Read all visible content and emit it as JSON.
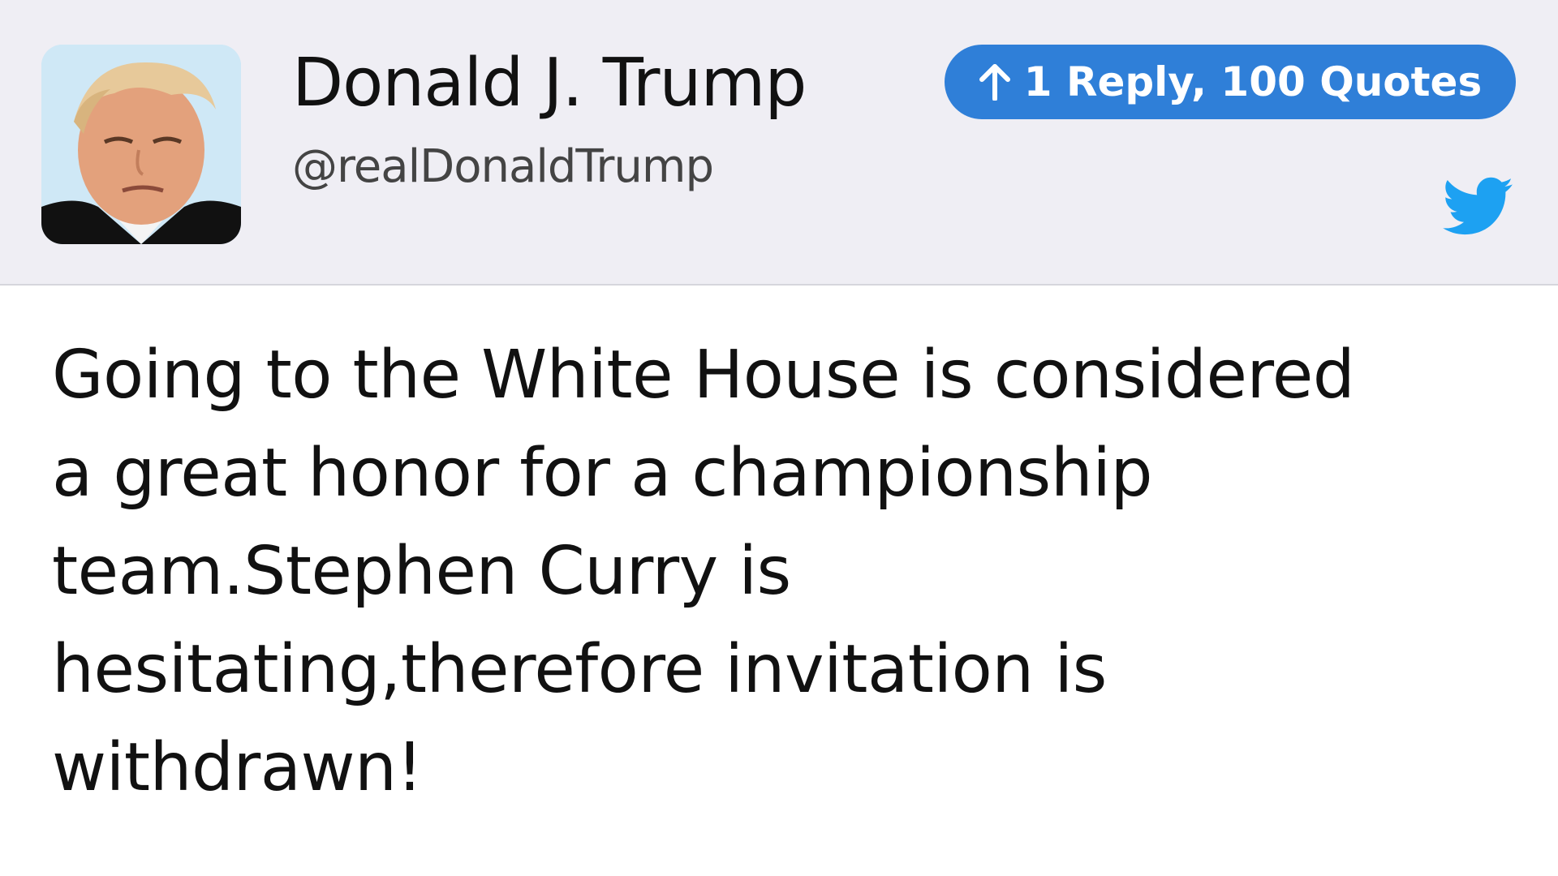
{
  "author": {
    "name": "Donald J. Trump",
    "handle": "@realDonaldTrump",
    "avatar": "profile-photo"
  },
  "engagement": {
    "label": "1 Reply, 100 Quotes",
    "icon": "arrow-up-icon"
  },
  "platform_icon": "twitter-bird-icon",
  "tweet": {
    "text": "Going to the White House is considered\na great honor for a championship\nteam.Stephen Curry is\nhesitating,therefore invitation is\nwithdrawn!"
  },
  "colors": {
    "header_bg": "#efeef4",
    "pill_bg": "#2f7fd8",
    "twitter_blue": "#1da1f2",
    "text": "#111111"
  }
}
